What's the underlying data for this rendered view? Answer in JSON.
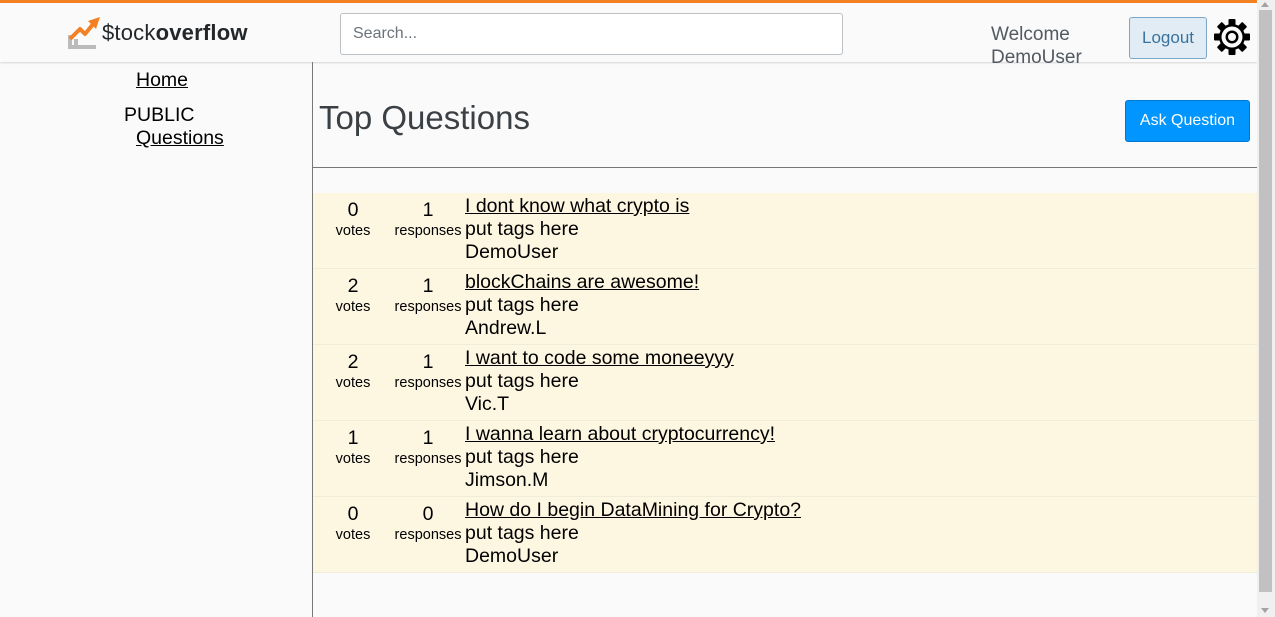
{
  "header": {
    "logo_prefix": "$tock",
    "logo_suffix": "overflow",
    "search_placeholder": "Search...",
    "welcome_line1": "Welcome",
    "welcome_line2": "DemoUser",
    "logout_label": "Logout",
    "accent_color": "#f48024"
  },
  "sidebar": {
    "home_label": "Home",
    "public_label": "PUBLIC",
    "questions_label": "Questions"
  },
  "main": {
    "title": "Top Questions",
    "ask_button_label": "Ask Question",
    "ask_button_color": "#0095ff",
    "questions": [
      {
        "votes": "0",
        "votes_label": "votes",
        "responses": "1",
        "responses_label": "responses",
        "title": "I dont know what crypto is",
        "tags": "put tags here",
        "author": "DemoUser"
      },
      {
        "votes": "2",
        "votes_label": "votes",
        "responses": "1",
        "responses_label": "responses",
        "title": "blockChains are awesome!",
        "tags": "put tags here",
        "author": "Andrew.L"
      },
      {
        "votes": "2",
        "votes_label": "votes",
        "responses": "1",
        "responses_label": "responses",
        "title": "I want to code some moneeyyy",
        "tags": "put tags here",
        "author": "Vic.T"
      },
      {
        "votes": "1",
        "votes_label": "votes",
        "responses": "1",
        "responses_label": "responses",
        "title": "I wanna learn about cryptocurrency!",
        "tags": "put tags here",
        "author": "Jimson.M"
      },
      {
        "votes": "0",
        "votes_label": "votes",
        "responses": "0",
        "responses_label": "responses",
        "title": "How do I begin DataMining for Crypto?",
        "tags": "put tags here",
        "author": "DemoUser"
      }
    ]
  },
  "icons": {
    "logo": "stock-chart-logo-icon",
    "settings": "gear-icon"
  }
}
